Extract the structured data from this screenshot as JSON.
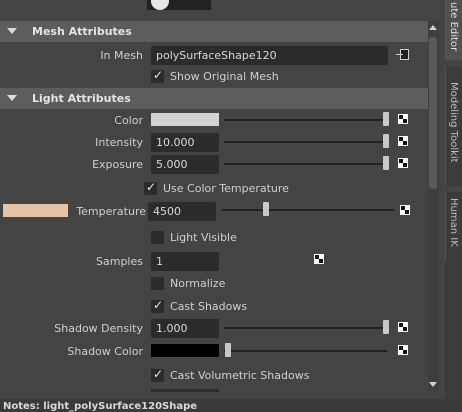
{
  "mesh_attributes": {
    "title": "Mesh Attributes",
    "in_mesh_label": "In Mesh",
    "in_mesh_value": "polySurfaceShape120",
    "show_original_mesh_label": "Show Original Mesh",
    "show_original_mesh": true
  },
  "light_attributes": {
    "title": "Light Attributes",
    "color_label": "Color",
    "color_swatch": "#d2d2d2",
    "intensity_label": "Intensity",
    "intensity_value": "10.000",
    "exposure_label": "Exposure",
    "exposure_value": "5.000",
    "use_color_temperature_label": "Use Color Temperature",
    "use_color_temperature": true,
    "temperature_swatch": "#e6c2a6",
    "temperature_label": "Temperature",
    "temperature_value": "4500",
    "light_visible_label": "Light Visible",
    "light_visible": false,
    "samples_label": "Samples",
    "samples_value": "1",
    "normalize_label": "Normalize",
    "normalize": false,
    "cast_shadows_label": "Cast Shadows",
    "cast_shadows": true,
    "shadow_density_label": "Shadow Density",
    "shadow_density_value": "1.000",
    "shadow_color_label": "Shadow Color",
    "shadow_color_swatch": "#000000",
    "cast_volumetric_shadows_label": "Cast Volumetric Shadows",
    "cast_volumetric_shadows": true
  },
  "side_tabs": {
    "attribute_editor": "ute Editor",
    "modeling_toolkit": "Modeling Toolkit",
    "human_ik": "Human IK"
  },
  "notes": "Notes:  light_polySurface120Shape"
}
